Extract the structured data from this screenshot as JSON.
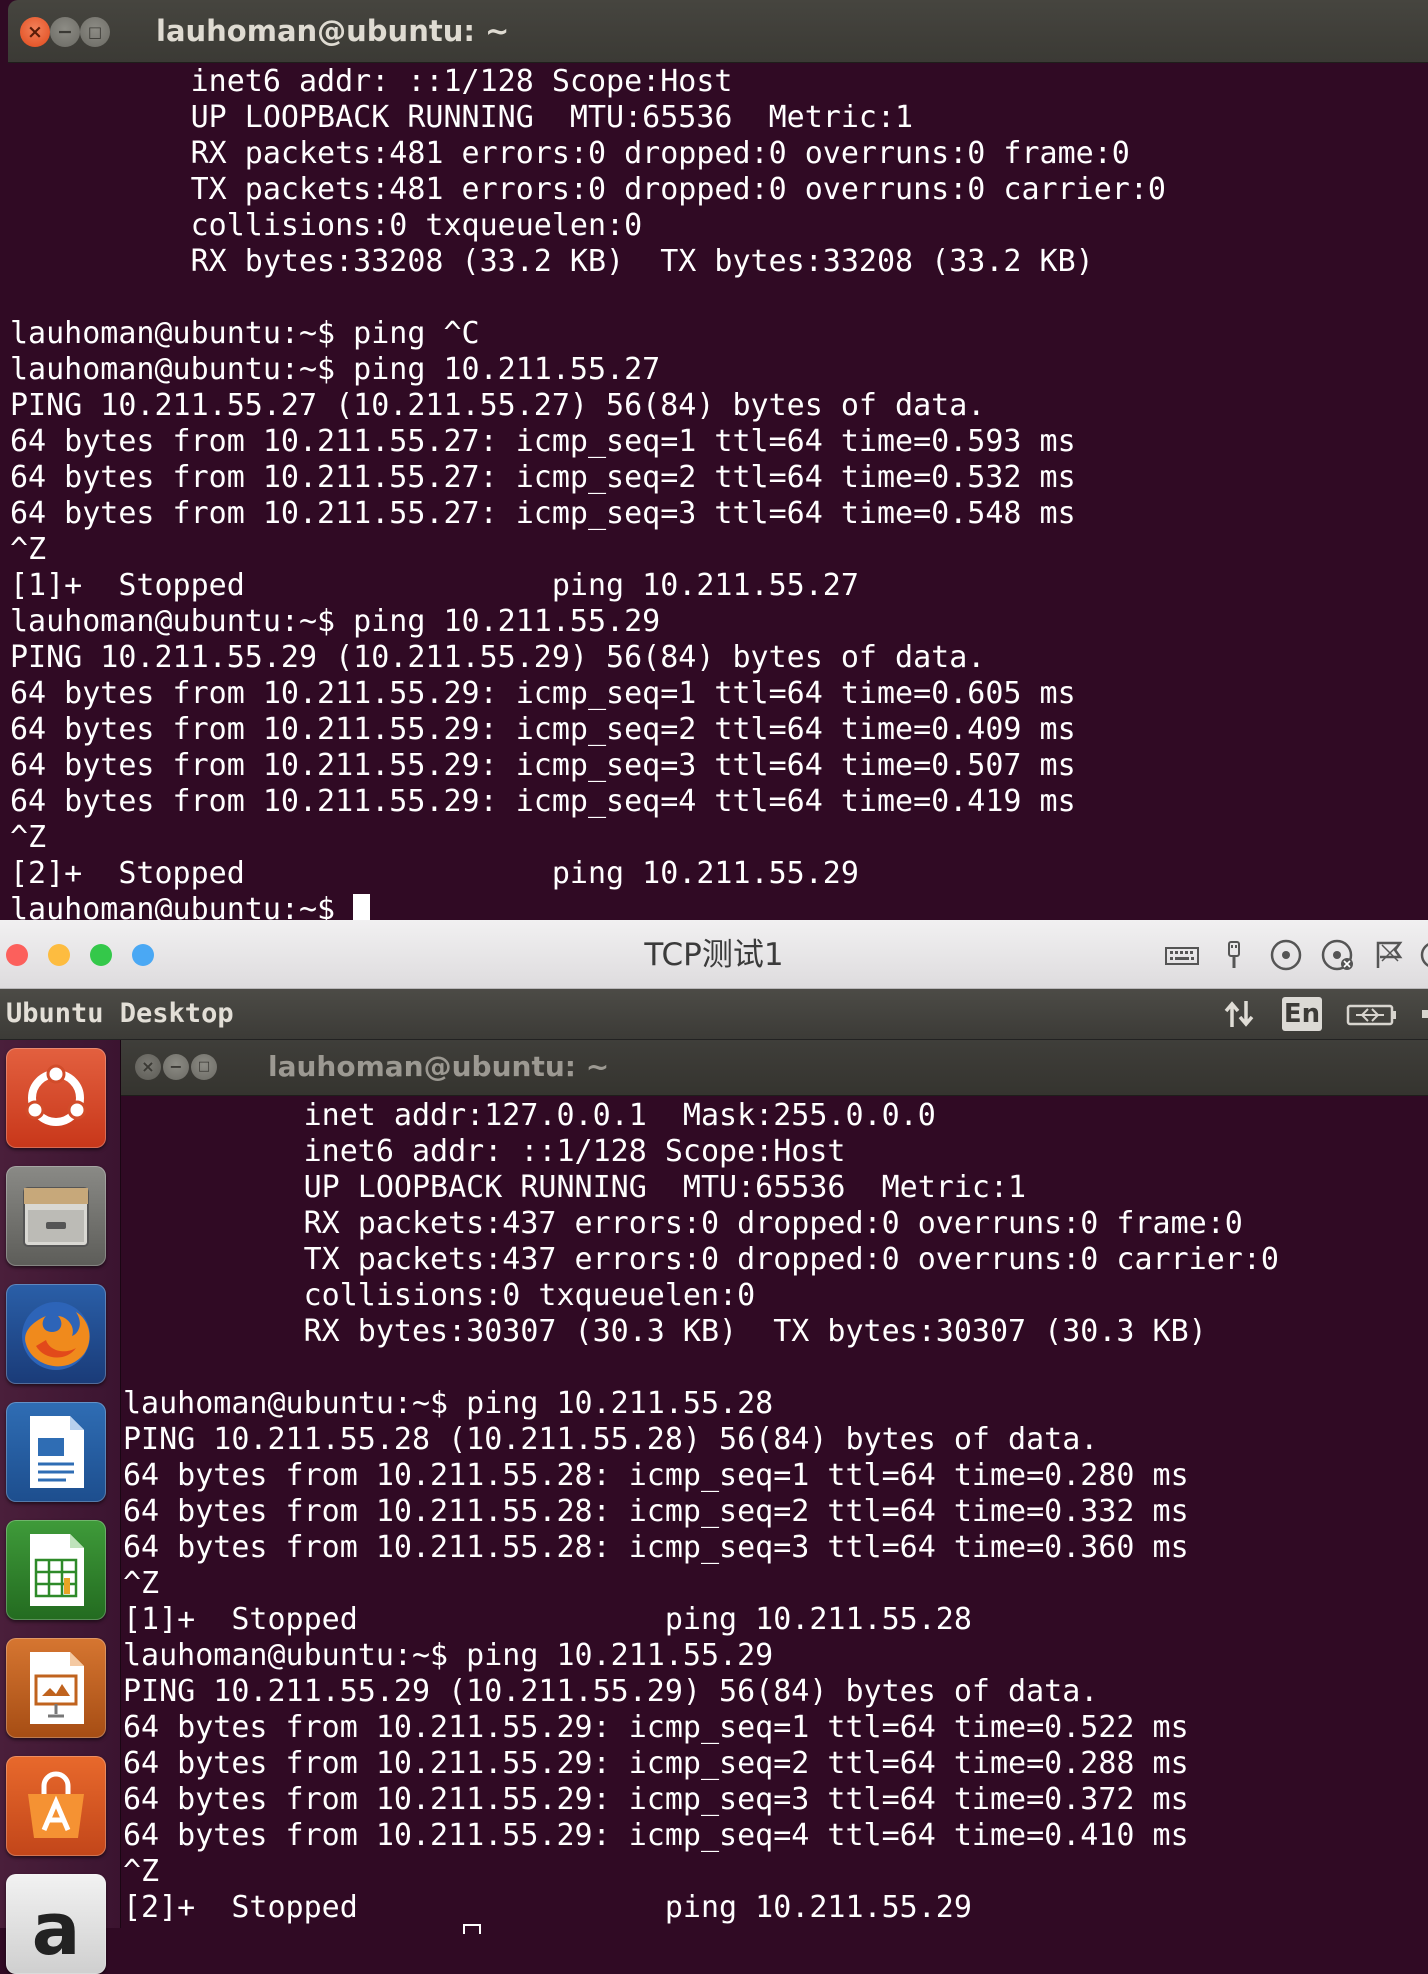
{
  "top_window": {
    "title": "lauhoman@ubuntu: ~",
    "lines": [
      "          inet6 addr: ::1/128 Scope:Host",
      "          UP LOOPBACK RUNNING  MTU:65536  Metric:1",
      "          RX packets:481 errors:0 dropped:0 overruns:0 frame:0",
      "          TX packets:481 errors:0 dropped:0 overruns:0 carrier:0",
      "          collisions:0 txqueuelen:0",
      "          RX bytes:33208 (33.2 KB)  TX bytes:33208 (33.2 KB)",
      "",
      "lauhoman@ubuntu:~$ ping ^C",
      "lauhoman@ubuntu:~$ ping 10.211.55.27",
      "PING 10.211.55.27 (10.211.55.27) 56(84) bytes of data.",
      "64 bytes from 10.211.55.27: icmp_seq=1 ttl=64 time=0.593 ms",
      "64 bytes from 10.211.55.27: icmp_seq=2 ttl=64 time=0.532 ms",
      "64 bytes from 10.211.55.27: icmp_seq=3 ttl=64 time=0.548 ms",
      "^Z",
      "[1]+  Stopped                 ping 10.211.55.27",
      "lauhoman@ubuntu:~$ ping 10.211.55.29",
      "PING 10.211.55.29 (10.211.55.29) 56(84) bytes of data.",
      "64 bytes from 10.211.55.29: icmp_seq=1 ttl=64 time=0.605 ms",
      "64 bytes from 10.211.55.29: icmp_seq=2 ttl=64 time=0.409 ms",
      "64 bytes from 10.211.55.29: icmp_seq=3 ttl=64 time=0.507 ms",
      "64 bytes from 10.211.55.29: icmp_seq=4 ttl=64 time=0.419 ms",
      "^Z",
      "[2]+  Stopped                 ping 10.211.55.29"
    ],
    "prompt": "lauhoman@ubuntu:~$ "
  },
  "vm_window": {
    "title": "TCP测试1",
    "panel_title": "Ubuntu Desktop",
    "lang_indicator": "En",
    "traffic_colors": [
      "#fc605c",
      "#fdbc40",
      "#34c84a",
      "#4aa8f4"
    ],
    "toolbar_icons": [
      "keyboard-icon",
      "usb-icon",
      "cd-icon",
      "disc-eject-icon",
      "flag-icon"
    ],
    "launcher_icons": [
      "ubuntu-dash-icon",
      "files-icon",
      "firefox-icon",
      "writer-icon",
      "calc-icon",
      "impress-icon",
      "software-center-icon",
      "amazon-icon"
    ]
  },
  "inner_window": {
    "title": "lauhoman@ubuntu: ~",
    "lines": [
      "          inet addr:127.0.0.1  Mask:255.0.0.0",
      "          inet6 addr: ::1/128 Scope:Host",
      "          UP LOOPBACK RUNNING  MTU:65536  Metric:1",
      "          RX packets:437 errors:0 dropped:0 overruns:0 frame:0",
      "          TX packets:437 errors:0 dropped:0 overruns:0 carrier:0",
      "          collisions:0 txqueuelen:0",
      "          RX bytes:30307 (30.3 KB)  TX bytes:30307 (30.3 KB)",
      "",
      "lauhoman@ubuntu:~$ ping 10.211.55.28",
      "PING 10.211.55.28 (10.211.55.28) 56(84) bytes of data.",
      "64 bytes from 10.211.55.28: icmp_seq=1 ttl=64 time=0.280 ms",
      "64 bytes from 10.211.55.28: icmp_seq=2 ttl=64 time=0.332 ms",
      "64 bytes from 10.211.55.28: icmp_seq=3 ttl=64 time=0.360 ms",
      "^Z",
      "[1]+  Stopped                 ping 10.211.55.28",
      "lauhoman@ubuntu:~$ ping 10.211.55.29",
      "PING 10.211.55.29 (10.211.55.29) 56(84) bytes of data.",
      "64 bytes from 10.211.55.29: icmp_seq=1 ttl=64 time=0.522 ms",
      "64 bytes from 10.211.55.29: icmp_seq=2 ttl=64 time=0.288 ms",
      "64 bytes from 10.211.55.29: icmp_seq=3 ttl=64 time=0.372 ms",
      "64 bytes from 10.211.55.29: icmp_seq=4 ttl=64 time=0.410 ms",
      "^Z",
      "[2]+  Stopped                 ping 10.211.55.29"
    ]
  },
  "colors": {
    "terminal_bg": "#300a24",
    "terminal_fg": "#ffffff",
    "close_orange": "#e0491b"
  }
}
